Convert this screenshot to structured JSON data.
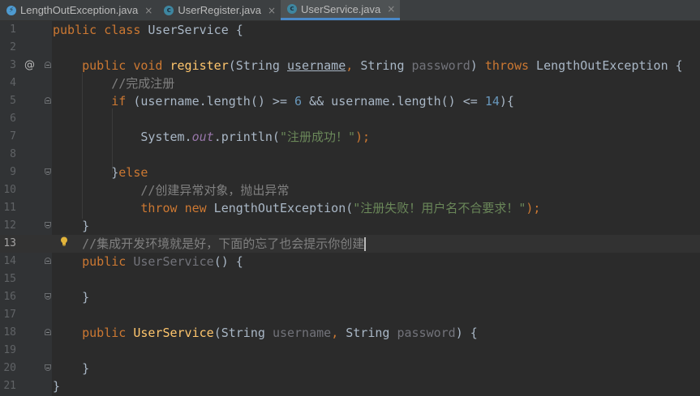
{
  "tabs": [
    {
      "label": "LengthOutException.java",
      "icon": "exception-class-icon",
      "active": false,
      "close": "×"
    },
    {
      "label": "UserRegister.java",
      "icon": "class-icon",
      "active": false,
      "close": "×"
    },
    {
      "label": "UserService.java",
      "icon": "class-icon",
      "active": true,
      "close": "×"
    }
  ],
  "gutter": {
    "line_numbers": [
      "1",
      "2",
      "3",
      "4",
      "5",
      "6",
      "7",
      "8",
      "9",
      "10",
      "11",
      "12",
      "13",
      "14",
      "15",
      "16",
      "17",
      "18",
      "19",
      "20",
      "21"
    ],
    "override_marker": "@",
    "current_line": "13"
  },
  "code": {
    "l1": {
      "kw": "public class ",
      "name": "UserService",
      "rest": " {"
    },
    "l3": {
      "kw1": "public void ",
      "fn": "register",
      "p1": "(String ",
      "arg1": "username",
      "comma": ", ",
      "t2": "String ",
      "arg2": "password",
      "close": ") ",
      "kw2": "throws",
      "rest": " LengthOutException {"
    },
    "l4": {
      "comment": "//完成注册"
    },
    "l5": {
      "kw": "if",
      "a": " (username.length() >= ",
      "n1": "6",
      "b": " && username.length() <= ",
      "n2": "14",
      "c": "){"
    },
    "l7": {
      "a": "System.",
      "out": "out",
      "b": ".println(",
      "str": "\"注册成功！\"",
      "c": ");"
    },
    "l9": {
      "brace": "}",
      "kw": "else"
    },
    "l10": {
      "comment": "//创建异常对象，抛出异常"
    },
    "l11": {
      "kw1": "throw ",
      "kw2": "new",
      "a": " LengthOutException(",
      "str": "\"注册失败！用户名不合要求！\"",
      "c": ");"
    },
    "l12": {
      "text": "}"
    },
    "l13": {
      "comment": "//集成开发环境就是好，下面的忘了也会提示你创建"
    },
    "l14": {
      "kw": "public ",
      "name": "UserService",
      "rest": "() {"
    },
    "l16": {
      "text": "}"
    },
    "l18": {
      "kw": "public ",
      "fn": "UserService",
      "p1": "(String ",
      "arg1": "username",
      "comma": ", ",
      "t2": "String ",
      "arg2": "password",
      "rest": ") {"
    },
    "l20": {
      "text": "}"
    },
    "l21": {
      "text": "}"
    }
  },
  "colors": {
    "background": "#2b2b2b",
    "keyword": "#cc7832",
    "function": "#ffc66d",
    "number": "#6897bb",
    "string": "#6a8759",
    "comment": "#808080",
    "active_tab_underline": "#4a88c7"
  }
}
